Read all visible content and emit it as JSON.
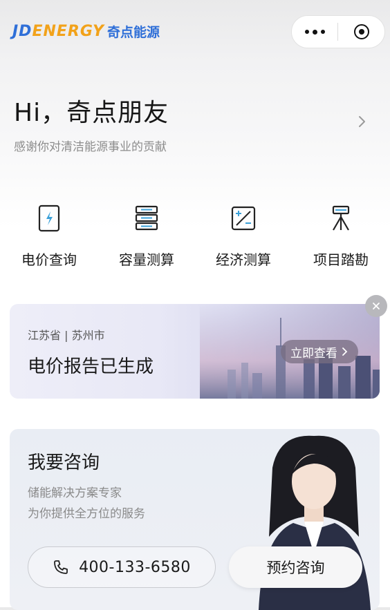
{
  "header": {
    "logo_en_prefix": "JD",
    "logo_en_rest": "ENERGY",
    "logo_cn": "奇点能源"
  },
  "greeting": {
    "title": "Hi，奇点朋友",
    "subtitle": "感谢你对清洁能源事业的贡献"
  },
  "features": [
    {
      "label": "电价查询",
      "icon": "battery-bolt-icon"
    },
    {
      "label": "容量测算",
      "icon": "server-stack-icon"
    },
    {
      "label": "经济测算",
      "icon": "calculator-icon"
    },
    {
      "label": "项目踏勘",
      "icon": "survey-tripod-icon"
    }
  ],
  "banner": {
    "location": "江苏省 | 苏州市",
    "title": "电价报告已生成",
    "button": "立即查看"
  },
  "consult": {
    "title": "我要咨询",
    "line1": "储能解决方案专家",
    "line2": "为你提供全方位的服务",
    "phone": "400-133-6580",
    "book_button": "预约咨询"
  },
  "colors": {
    "brand_blue": "#2f6fd8",
    "brand_orange": "#f2a21a"
  }
}
